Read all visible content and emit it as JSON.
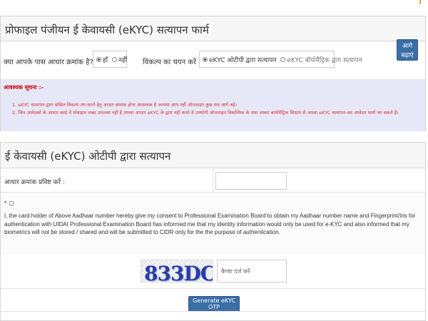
{
  "profile_panel": {
    "title": "प्रोफाइल पंजीयन ई केवायसी (eKYC) सत्यापन फार्म",
    "aadhaar_question": "क्या आपके पास आधार क्रमांक है?",
    "yes_label": "हाँ",
    "no_label": "नहीं",
    "selected_aadhaar_option": "हाँ",
    "select_option_label": "विकल्प का चयन करें",
    "ekyc_otp_option": "eKYC ओटीपी द्वारा सत्यापन",
    "ekyc_biometric_option": "eKYC बॉयोमैट्रिक द्वारा सत्यापन",
    "selected_ekyc_option": "eKYC ओटीपी द्वारा सत्यापन",
    "go_button": "आगे बढ़ाएं"
  },
  "important_notice": {
    "title": "आवश्यक सूचना :-",
    "items": [
      "1. eKYC सत्यापन द्वारा वांछित विकल्प तय करने हेतु आधार क्रमांक होना आवश्यक है अन्यथा आप नहीं ऑनलाइन कुछ सत्र आगे बढ़ें।",
      "2. जिन आवेदकों के आधार कार्ड में मोबाइल नम्बर उपलब्ध नहीं है अथवा आधार eKYC के द्वारा नहीं करते वे उपयोगी ऑनलाइन विकल्पिक के पास जाकर बायोमैट्रिक सिस्टम से अथवा eKYC सत्यापन कर आवेदन फार्म भर सकते हैं।"
    ]
  },
  "ekyc_panel": {
    "title": "ई केवायसी (eKYC) ओटीपी द्वारा सत्यापन",
    "aadhaar_input_label": "आधार क्रमांक प्रविष्ट करें :",
    "aadhaar_input_value": "",
    "consent_text": "I, the card holder of Above Aadhaar number hereby give my consent to Professional Examination Board to obtain my Aadhaar number name and Fingerprint/Iris for authentication with UIDAI Professional Examination Board has informed me that my identity information would only be used for e-KYC and also informed that my biometrics will not be stored / shared and will be submitted to CIDR only for the the purpose of authentication.",
    "captcha_text": "833DC",
    "captcha_placeholder": "कैप्चा दर्ज करें",
    "otp_button": "Generate eKYC OTP"
  }
}
